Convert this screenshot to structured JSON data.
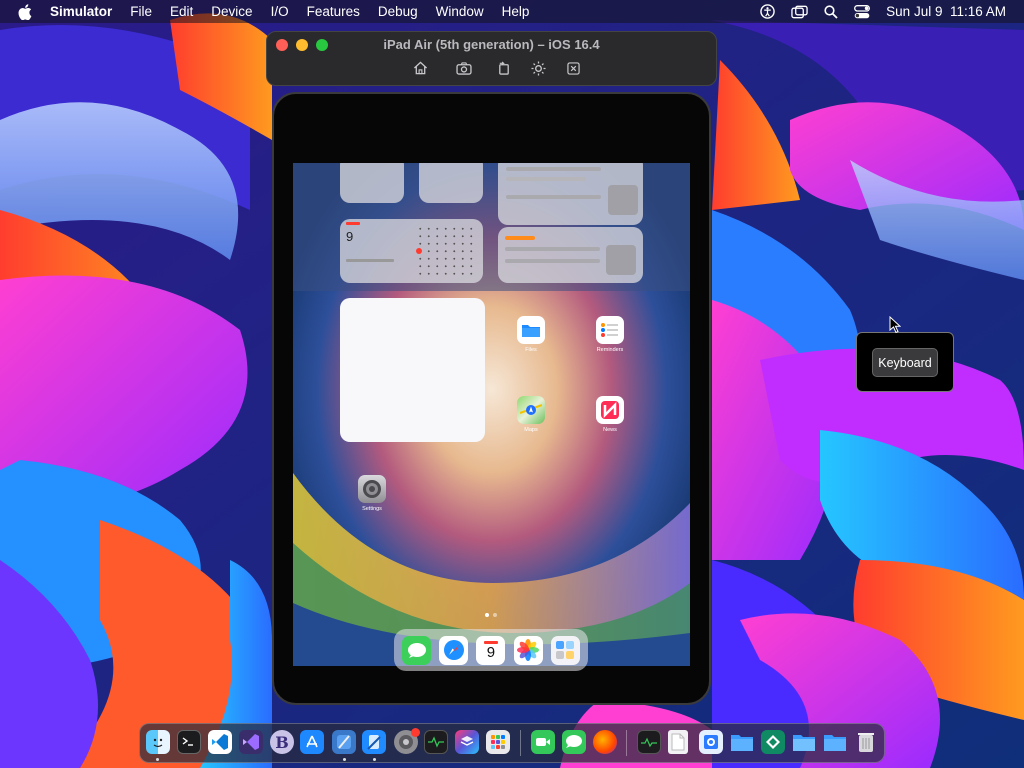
{
  "menubar": {
    "app_name": "Simulator",
    "menus": [
      "File",
      "Edit",
      "Device",
      "I/O",
      "Features",
      "Debug",
      "Window",
      "Help"
    ],
    "datetime": "Sun Jul 9  11:16 AM"
  },
  "simulator": {
    "title": "iPad Air (5th generation) – iOS 16.4",
    "toolbar": [
      "home-icon",
      "screenshot-icon",
      "rotate-icon",
      "appearance-icon",
      "close-square-icon"
    ]
  },
  "ipad": {
    "calendar_widget": {
      "day": "9"
    },
    "apps": [
      {
        "name": "Files"
      },
      {
        "name": "Reminders"
      },
      {
        "name": "Maps"
      },
      {
        "name": "News"
      },
      {
        "name": "Settings"
      }
    ],
    "dock_calendar_day": "9"
  },
  "popup": {
    "keyboard_label": "Keyboard"
  },
  "colors": {
    "accent_red": "#ff5f57",
    "accent_yellow": "#febc2e",
    "accent_green": "#28c840"
  }
}
